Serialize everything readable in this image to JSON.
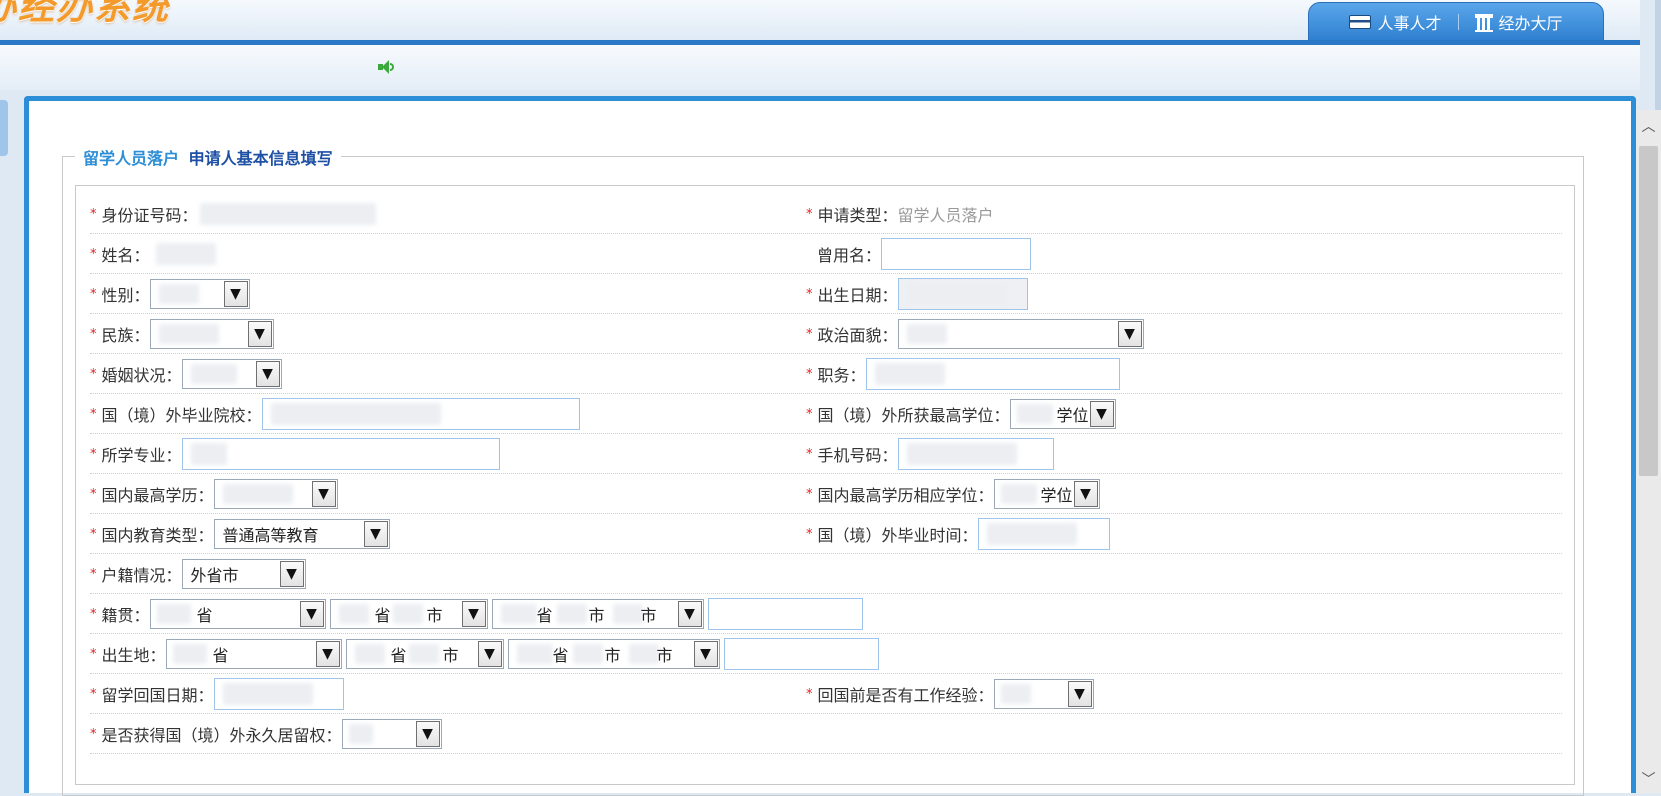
{
  "header": {
    "system_title": "办经办系统",
    "nav_tabs": [
      {
        "label": "人事人才",
        "icon": "book-icon"
      },
      {
        "label": "经办大厅",
        "icon": "hall-icon"
      }
    ]
  },
  "subbar": {
    "icon": "speaker-icon"
  },
  "form": {
    "legend_prefix": "留学人员落户",
    "legend_title": "申请人基本信息填写",
    "fields": {
      "id_number": {
        "label": "身份证号码："
      },
      "apply_type": {
        "label": "申请类型：",
        "value": "留学人员落户"
      },
      "name": {
        "label": "姓名："
      },
      "former_name": {
        "label": "曾用名：",
        "value": ""
      },
      "gender": {
        "label": "性别："
      },
      "birth_date": {
        "label": "出生日期："
      },
      "ethnicity": {
        "label": "民族："
      },
      "political": {
        "label": "政治面貌："
      },
      "marital": {
        "label": "婚姻状况："
      },
      "position": {
        "label": "职务："
      },
      "foreign_school": {
        "label": "国（境）外毕业院校："
      },
      "foreign_degree": {
        "label": "国（境）外所获最高学位：",
        "value": "学位"
      },
      "major": {
        "label": "所学专业："
      },
      "mobile": {
        "label": "手机号码："
      },
      "domestic_edu": {
        "label": "国内最高学历："
      },
      "domestic_degree": {
        "label": "国内最高学历相应学位：",
        "value": "学位"
      },
      "edu_type": {
        "label": "国内教育类型：",
        "value": "普通高等教育"
      },
      "foreign_grad_time": {
        "label": "国（境）外毕业时间："
      },
      "household": {
        "label": "户籍情况：",
        "value": "外省市"
      },
      "native_place": {
        "label": "籍贯：",
        "province": "省",
        "city_prov": "省",
        "city": "市",
        "county_prov": "省",
        "county_city": "市",
        "county": "市"
      },
      "birth_place": {
        "label": "出生地：",
        "province": "省",
        "city_prov": "省",
        "city": "市",
        "county_prov": "省",
        "county_city": "市",
        "county": "市"
      },
      "return_date": {
        "label": "留学回国日期："
      },
      "work_experience": {
        "label": "回国前是否有工作经验："
      },
      "permanent_residence": {
        "label": "是否获得国（境）外永久居留权："
      }
    }
  },
  "colors": {
    "primary": "#2b8ed6",
    "required": "#e02020",
    "title_orange": "#f39a2a"
  }
}
